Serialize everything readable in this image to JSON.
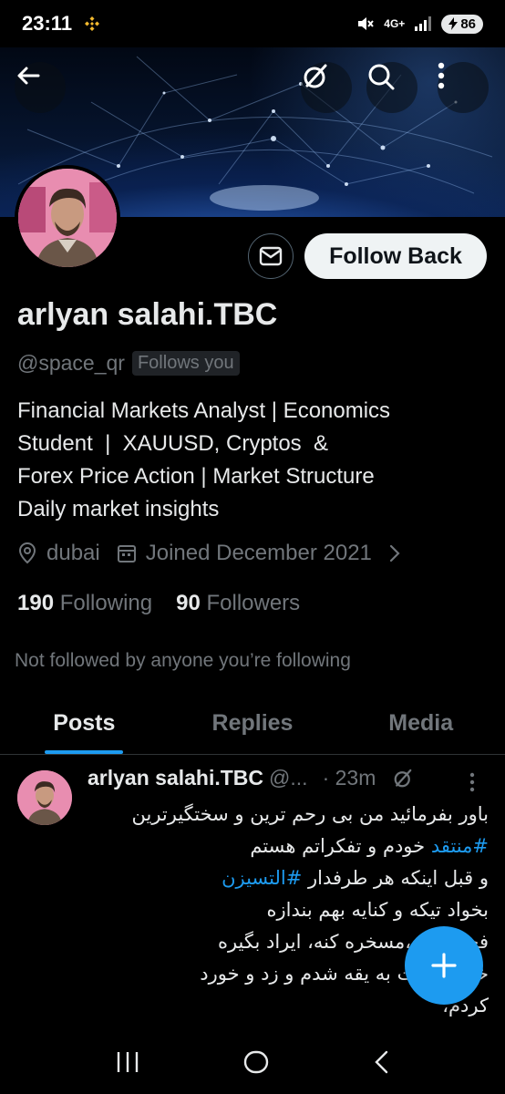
{
  "status_bar": {
    "time": "23:11",
    "network": "4G+",
    "battery": "86"
  },
  "profile": {
    "name": "arlyan salahi.TBC",
    "handle": "@space_qr",
    "follows_you": "Follows you",
    "follow_button": "Follow Back",
    "bio": [
      "Financial Markets Analyst | Economics",
      "Student  |  XAUUSD, Cryptos  &",
      "Forex Price Action | Market Structure",
      "Daily market insights"
    ],
    "location": "dubai",
    "joined": "Joined December 2021",
    "following_count": "190",
    "following_label": "Following",
    "followers_count": "90",
    "followers_label": "Followers",
    "not_followed": "Not followed by anyone you’re following"
  },
  "tabs": [
    {
      "label": "Posts",
      "active": true
    },
    {
      "label": "Replies",
      "active": false
    },
    {
      "label": "Media",
      "active": false
    }
  ],
  "post": {
    "author": "arlyan salahi.TBC",
    "handle": "@...",
    "time": "· 23m",
    "lines": [
      {
        "text": "باور بفرمائید من بی رحم ترین و سختگیرترین"
      },
      {
        "hashtag": "#منتقد",
        "text": " خودم و تفکراتم هستم"
      },
      {
        "pre": "و قبل اینکه هر طرفدار ",
        "hashtag": "#التسیزن"
      },
      {
        "text": "بخواد تیکه و کنایه بهم بندازه"
      },
      {
        "text": "فحش بده،مسخره کنه، ایراد بگیره"
      },
      {
        "text": "خودم دست به یقه شدم و زد و خورد"
      },
      {
        "text": "کردم،"
      }
    ]
  },
  "colors": {
    "accent": "#1d9bf0",
    "background": "#000000",
    "muted": "#71767b",
    "text": "#e7e9ea"
  }
}
